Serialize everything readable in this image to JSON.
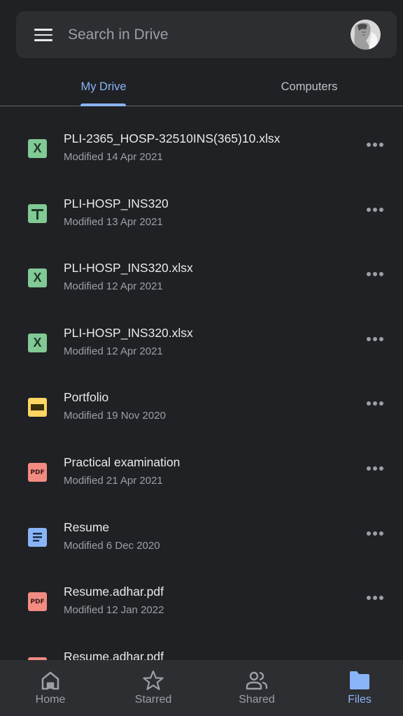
{
  "search": {
    "placeholder": "Search in Drive",
    "value": ""
  },
  "tabs": [
    {
      "label": "My Drive",
      "active": true
    },
    {
      "label": "Computers",
      "active": false
    }
  ],
  "files": [
    {
      "name": "PLI-2365_HOSP-32510INS(365)10.xlsx",
      "modified": "Modified 14 Apr 2021",
      "type": "excel-icon",
      "icon_text": "X"
    },
    {
      "name": "PLI-HOSP_INS320",
      "modified": "Modified 13 Apr 2021",
      "type": "sheets-icon",
      "icon_text": ""
    },
    {
      "name": "PLI-HOSP_INS320.xlsx",
      "modified": "Modified 12 Apr 2021",
      "type": "excel-icon",
      "icon_text": "X"
    },
    {
      "name": "PLI-HOSP_INS320.xlsx",
      "modified": "Modified 12 Apr 2021",
      "type": "excel-icon",
      "icon_text": "X"
    },
    {
      "name": "Portfolio",
      "modified": "Modified 19 Nov 2020",
      "type": "slides-icon",
      "icon_text": ""
    },
    {
      "name": "Practical examination",
      "modified": "Modified 21 Apr 2021",
      "type": "pdf-icon",
      "icon_text": "PDF"
    },
    {
      "name": "Resume",
      "modified": "Modified 6 Dec 2020",
      "type": "docs-icon",
      "icon_text": ""
    },
    {
      "name": "Resume.adhar.pdf",
      "modified": "Modified 12 Jan 2022",
      "type": "pdf-icon",
      "icon_text": "PDF"
    },
    {
      "name": "Resume.adhar.pdf",
      "modified": "",
      "type": "pdf-icon",
      "icon_text": "PDF"
    }
  ],
  "bottom_nav": [
    {
      "label": "Home",
      "icon": "home-icon",
      "active": false
    },
    {
      "label": "Starred",
      "icon": "star-icon",
      "active": false
    },
    {
      "label": "Shared",
      "icon": "shared-icon",
      "active": false
    },
    {
      "label": "Files",
      "icon": "folder-icon",
      "active": true
    }
  ],
  "colors": {
    "background": "#202124",
    "surface": "#2d2e31",
    "accent": "#8ab4f8",
    "sheets": "#81c995",
    "slides": "#fdd663",
    "pdf": "#f28b82",
    "docs": "#8ab4f8"
  }
}
